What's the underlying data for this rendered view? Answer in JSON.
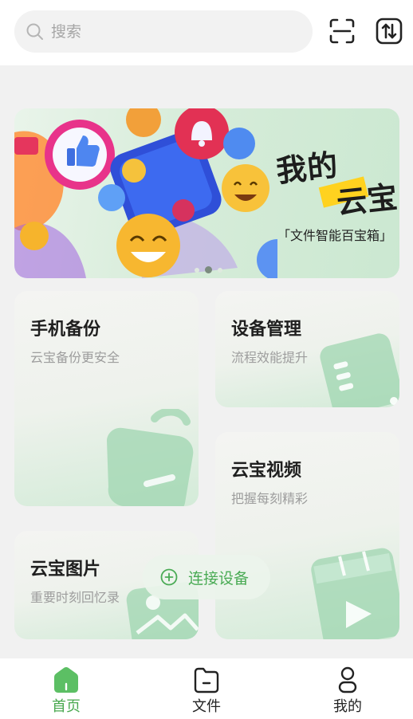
{
  "search": {
    "placeholder": "搜索"
  },
  "banner": {
    "title_line1": "我的",
    "title_line2": "云宝",
    "subtitle": "「文件智能百宝箱」",
    "dots_total": 3,
    "dots_active_index": 1
  },
  "cards": {
    "phone_backup": {
      "title": "手机备份",
      "subtitle": "云宝备份更安全"
    },
    "device_manage": {
      "title": "设备管理",
      "subtitle": "流程效能提升"
    },
    "yunbao_video": {
      "title": "云宝视频",
      "subtitle": "把握每刻精彩"
    },
    "yunbao_photo": {
      "title": "云宝图片",
      "subtitle": "重要时刻回忆录"
    }
  },
  "connect": {
    "label": "连接设备"
  },
  "nav": {
    "home": "首页",
    "files": "文件",
    "mine": "我的",
    "active": "home"
  },
  "colors": {
    "accent_green": "#4aab55",
    "nav_active_green": "#49a84f",
    "home_icon_green": "#5cbf64",
    "banner_yellow": "#ffd21f"
  },
  "icons": [
    "search-icon",
    "scan-icon",
    "transfer-icon",
    "plus-circle-icon",
    "home-icon",
    "folder-icon",
    "user-icon"
  ]
}
